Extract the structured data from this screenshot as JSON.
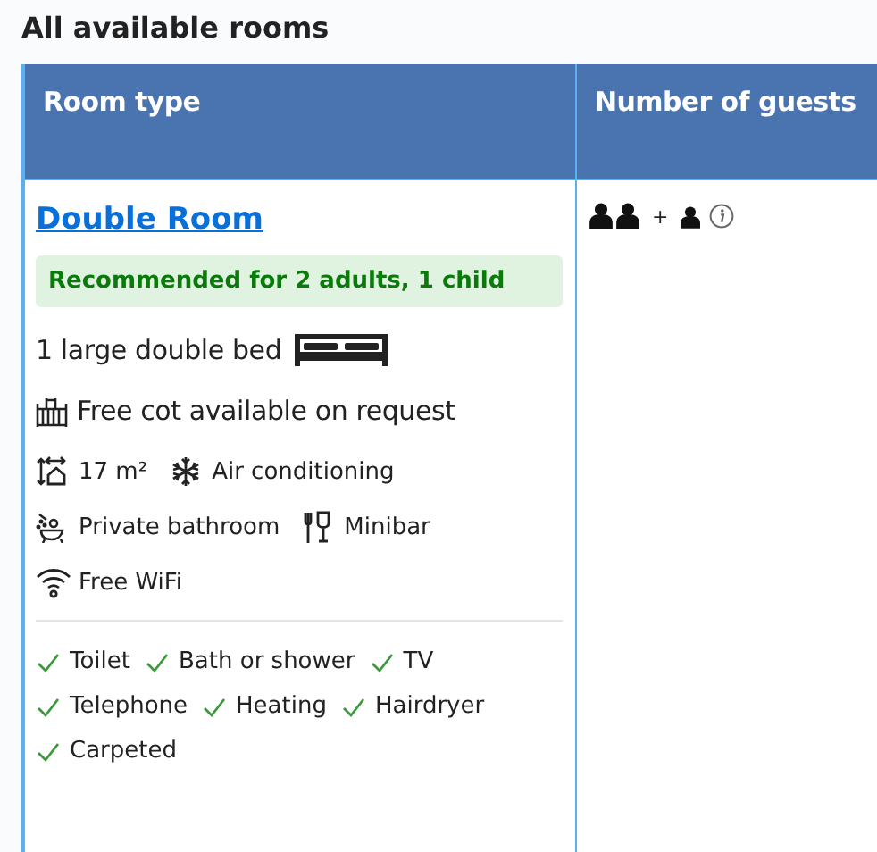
{
  "heading": "All available rooms",
  "columns": [
    "Room type",
    "Number of guests"
  ],
  "rooms": [
    {
      "name": "Double Room",
      "recommendation": "Recommended for 2 adults, 1 child",
      "bed": "1 large double bed",
      "cot": "Free cot available on request",
      "facilities": [
        [
          {
            "kind": "size",
            "label": "17 m²"
          },
          {
            "kind": "snowflake",
            "label": "Air conditioning"
          }
        ],
        [
          {
            "kind": "bath",
            "label": "Private bathroom"
          },
          {
            "kind": "minibar",
            "label": "Minibar"
          }
        ],
        [
          {
            "kind": "wifi",
            "label": "Free WiFi"
          }
        ]
      ],
      "amenities": [
        [
          "Toilet",
          "Bath or shower",
          "TV"
        ],
        [
          "Telephone",
          "Heating",
          "Hairdryer"
        ],
        [
          "Carpeted"
        ]
      ],
      "guests": [
        {
          "kind": "adult"
        },
        {
          "kind": "adult"
        },
        {
          "kind": "plus",
          "text": "+"
        },
        {
          "kind": "child"
        },
        {
          "kind": "info"
        }
      ]
    }
  ]
}
